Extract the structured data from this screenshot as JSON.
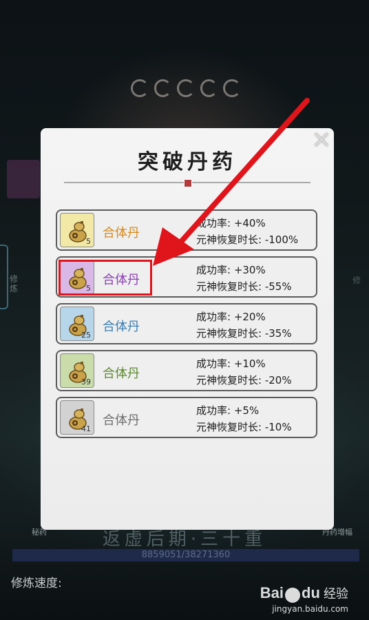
{
  "background": {
    "side_text_left": "修炼",
    "side_text_right": "修",
    "realm": "返虚后期·三十重",
    "small_left": "秘药",
    "small_right": "丹药增幅",
    "stat_bar": "8859051/38271360",
    "speed_label": "修炼速度:"
  },
  "dialog": {
    "title": "突破丹药",
    "close_icon": "close-icon",
    "items": [
      {
        "name": "合体丹",
        "count": "5",
        "success": "成功率: +40%",
        "recovery": "元神恢复时长: -100%",
        "bg": "#f2e9a6",
        "color": "#d8891a"
      },
      {
        "name": "合体丹",
        "count": "5",
        "success": "成功率: +30%",
        "recovery": "元神恢复时长: -55%",
        "bg": "#d9b8e8",
        "color": "#8a3fb0"
      },
      {
        "name": "合体丹",
        "count": "25",
        "success": "成功率: +20%",
        "recovery": "元神恢复时长: -35%",
        "bg": "#b7d6ea",
        "color": "#3b7fb3"
      },
      {
        "name": "合体丹",
        "count": "39",
        "success": "成功率: +10%",
        "recovery": "元神恢复时长: -20%",
        "bg": "#c9dcaa",
        "color": "#5b8a2e"
      },
      {
        "name": "合体丹",
        "count": "41",
        "success": "成功率: +5%",
        "recovery": "元神恢复时长: -10%",
        "bg": "#d2d2d2",
        "color": "#6e6e6e"
      }
    ]
  },
  "annotation": {
    "color": "#e0141b"
  },
  "watermark": {
    "brand_a": "Bai",
    "brand_b": "du",
    "cn": "经验",
    "url": "jingyan.baidu.com"
  }
}
